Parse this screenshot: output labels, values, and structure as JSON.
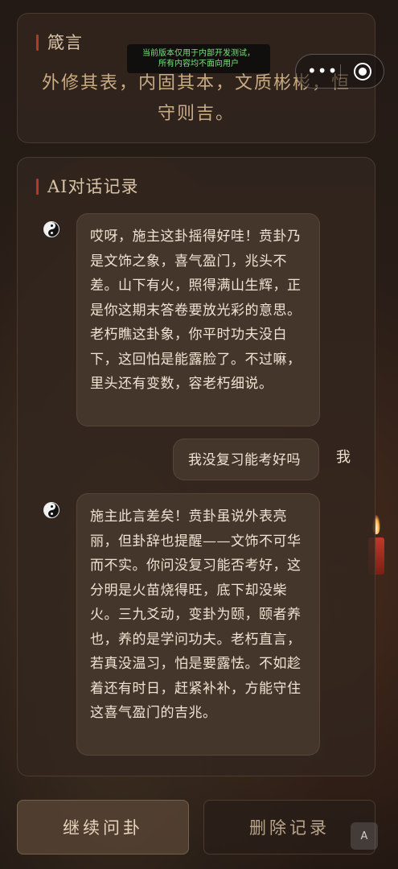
{
  "quote_card": {
    "title": "箴言",
    "text": "外修其表，内固其本，文质彬彬，恒守则吉。"
  },
  "chat_card": {
    "title": "AI对话记录",
    "messages": [
      {
        "role": "ai",
        "text": "哎呀，施主这卦摇得好哇！贲卦乃是文饰之象，喜气盈门，兆头不差。山下有火，照得满山生辉，正是你这期末答卷要放光彩的意思。老朽瞧这卦象，你平时功夫没白下，这回怕是能露脸了。不过嘛，里头还有变数，容老朽细说。"
      },
      {
        "role": "user",
        "label": "我",
        "text": "我没复习能考好吗"
      },
      {
        "role": "ai",
        "text": "施主此言差矣！贲卦虽说外表亮丽，但卦辞也提醒——文饰不可华而不实。你问没复习能否考好，这分明是火苗烧得旺，底下却没柴火。三九爻动，变卦为颐，颐者养也，养的是学问功夫。老朽直言，若真没温习，怕是要露怯。不如趁着还有时日，赶紧补补，方能守住这喜气盈门的吉兆。"
      }
    ]
  },
  "buttons": {
    "continue": "继续问卦",
    "delete": "删除记录"
  },
  "dev_notice": {
    "line1": "当前版本仅用于内部开发测试，",
    "line2": "所有内容均不面向用户"
  },
  "capsule": {
    "more_icon": "more-dots-icon",
    "close_icon": "target-icon"
  },
  "ai_badge": "A",
  "colors": {
    "accent_red": "#b23a2a",
    "quote_gold": "#c9ab83",
    "notice_green": "#7ee07e"
  }
}
